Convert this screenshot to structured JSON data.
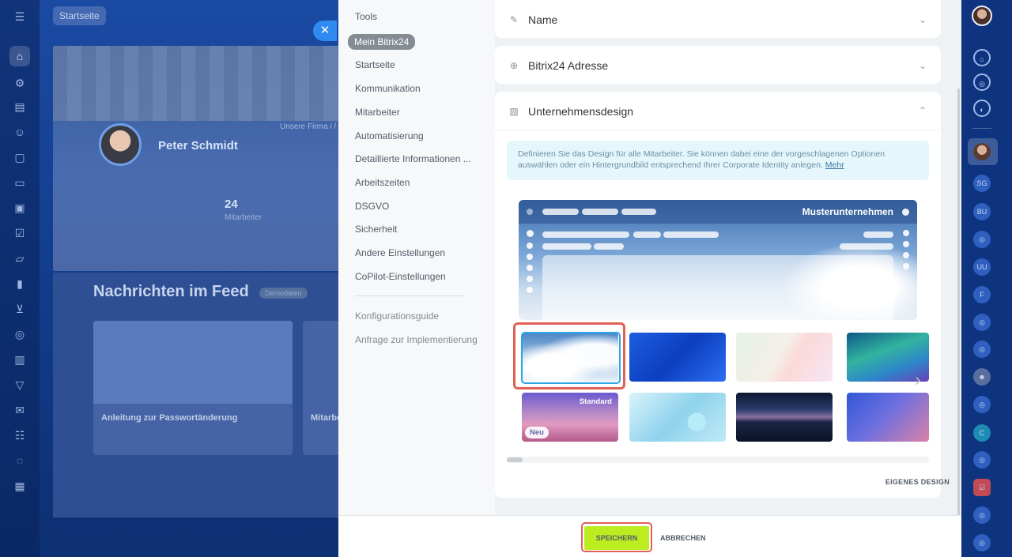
{
  "background": {
    "home_chip": "Startseite",
    "profile_name": "Peter Schmidt",
    "profile_desc": "Unsere Firma i / Wert auf innov / an Produkten, / Unternehmens",
    "employee_count": "24",
    "employee_label": "Mitarbeiter",
    "feed_title": "Nachrichten im Feed",
    "feed_badge": "Demodaten",
    "tile1_title": "Anleitung zur Passwortänderung",
    "tile2_title": "Mitarbe"
  },
  "nav": {
    "items": [
      {
        "label": "Tools"
      },
      {
        "label": "Mein Bitrix24"
      },
      {
        "label": "Startseite"
      },
      {
        "label": "Kommunikation"
      },
      {
        "label": "Mitarbeiter"
      },
      {
        "label": "Automatisierung"
      },
      {
        "label": "Detaillierte Informationen ..."
      },
      {
        "label": "Arbeitszeiten"
      },
      {
        "label": "DSGVO"
      },
      {
        "label": "Sicherheit"
      },
      {
        "label": "Andere Einstellungen"
      },
      {
        "label": "CoPilot-Einstellungen"
      }
    ],
    "secondary": [
      {
        "label": "Konfigurationsguide"
      },
      {
        "label": "Anfrage zur Implementierung"
      }
    ]
  },
  "sections": {
    "name": {
      "title": "Name"
    },
    "address": {
      "title": "Bitrix24 Adresse"
    },
    "design": {
      "title": "Unternehmensdesign",
      "info_text": "Definieren Sie das Design für alle Mitarbeiter. Sie können dabei eine der vorgeschlagenen Optionen auswählen oder ein Hintergrundbild entsprechend Ihrer Corporate Identity anlegen.",
      "info_link": "Mehr",
      "preview_title": "Musterunternehmen",
      "tag_standard": "Standard",
      "tag_new": "Neu",
      "own_design": "EIGENES DESIGN"
    }
  },
  "footer": {
    "save_label": "SPEICHERN",
    "cancel_label": "ABBRECHEN"
  },
  "right_rail": {
    "initials": [
      "SG",
      "BU",
      "UU",
      "F",
      "C"
    ]
  },
  "colors": {
    "accent_save": "#bbed21",
    "highlight": "#e06055",
    "selection": "#2ba5e6"
  }
}
